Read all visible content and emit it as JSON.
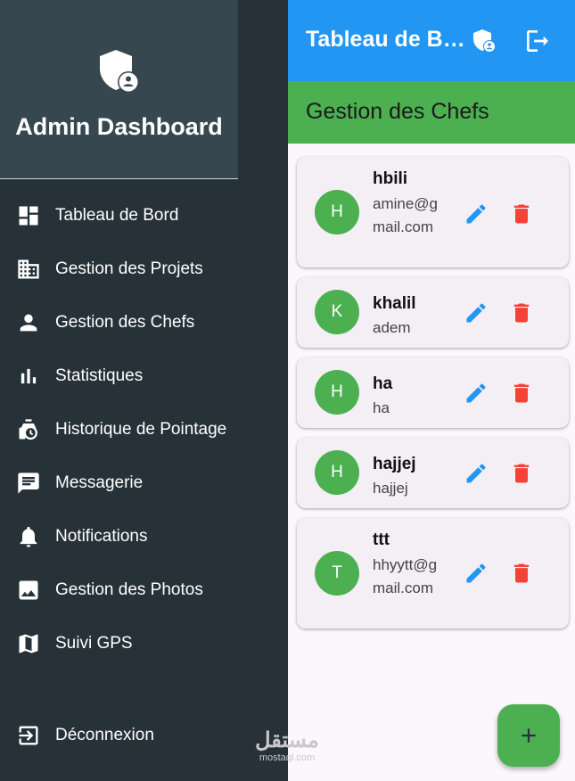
{
  "sidebar": {
    "title": "Admin Dashboard",
    "brand_icon": "admin-shield-icon",
    "items": [
      {
        "label": "Tableau de Bord",
        "icon": "dashboard-icon"
      },
      {
        "label": "Gestion des Projets",
        "icon": "building-icon"
      },
      {
        "label": "Gestion des Chefs",
        "icon": "person-icon"
      },
      {
        "label": "Statistiques",
        "icon": "bar-chart-icon"
      },
      {
        "label": "Historique de Pointage",
        "icon": "history-icon"
      },
      {
        "label": "Messagerie",
        "icon": "message-icon"
      },
      {
        "label": "Notifications",
        "icon": "bell-icon"
      },
      {
        "label": "Gestion des Photos",
        "icon": "photo-icon"
      },
      {
        "label": "Suivi GPS",
        "icon": "map-icon"
      }
    ],
    "logout_label": "Déconnexion"
  },
  "appbar": {
    "title": "Tableau de Bo...",
    "color": "#2196f3"
  },
  "section": {
    "title": "Gestion des Chefs",
    "color": "#4caf50"
  },
  "chefs": [
    {
      "initial": "H",
      "name": "hbili",
      "email": "amine@gmail.com"
    },
    {
      "initial": "K",
      "name": "khalil",
      "email": "adem"
    },
    {
      "initial": "H",
      "name": "ha",
      "email": "ha"
    },
    {
      "initial": "H",
      "name": "hajjej",
      "email": "hajjej"
    },
    {
      "initial": "T",
      "name": "ttt",
      "email": "hhyytt@gmail.com"
    }
  ],
  "fab": {
    "icon": "plus-icon"
  },
  "watermark": {
    "arabic": "مستقل",
    "latin": "mostaql.com"
  },
  "colors": {
    "edit": "#2196f3",
    "delete": "#f44336",
    "avatar": "#4caf50",
    "sidebar": "#263238"
  }
}
